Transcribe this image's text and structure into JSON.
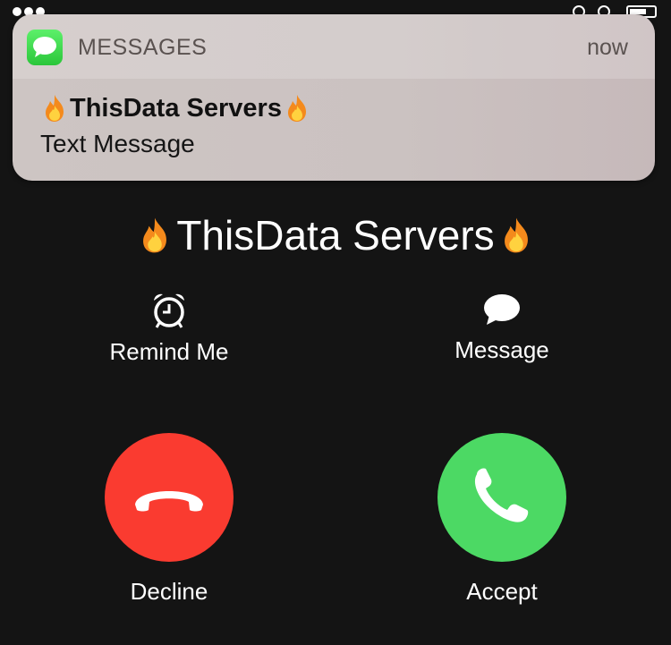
{
  "notification": {
    "app_name": "MESSAGES",
    "time": "now",
    "title_emoji_left": "fire-emoji",
    "title": "ThisData Servers",
    "title_emoji_right": "fire-emoji",
    "body": "Text Message",
    "app_icon": "messages-app-icon"
  },
  "call": {
    "caller_name": "ThisData Servers",
    "caller_emoji": "fire-emoji",
    "remind_label": "Remind Me",
    "remind_icon": "alarm-clock-icon",
    "message_label": "Message",
    "message_icon": "speech-bubble-icon",
    "decline_label": "Decline",
    "accept_label": "Accept"
  },
  "colors": {
    "background": "#141414",
    "decline": "#fa3b30",
    "accept": "#4cd964",
    "messages_green": "#34c759"
  }
}
